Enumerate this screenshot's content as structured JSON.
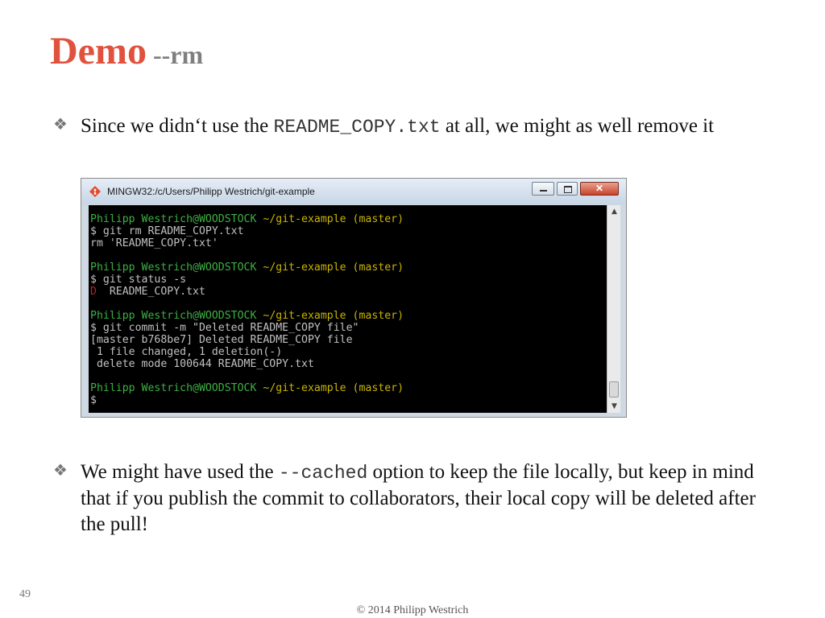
{
  "slide": {
    "title_main": "Demo",
    "title_sub": "--rm",
    "bullet1": {
      "pre": "Since we didn‘t use the ",
      "code": "README_COPY.txt",
      "post": " at all, we might as well remove it"
    },
    "bullet2": {
      "pre": "We might have used the ",
      "code": "--cached",
      "post": " option to keep the file locally, but keep in mind that if you publish the commit to collaborators, their local copy will be deleted after the pull!"
    },
    "bullet_icon": "diamond-bullet-icon",
    "page_number": "49",
    "footer": "© 2014 Philipp Westrich"
  },
  "terminal": {
    "window_title": "MINGW32:/c/Users/Philipp Westrich/git-example",
    "app_icon": "git-diamond-icon",
    "close_symbol": "✕",
    "scroll_up": "▲",
    "scroll_down": "▼",
    "prompt_user": "Philipp Westrich@WOODSTOCK",
    "prompt_path": "~/git-example (master)",
    "lines": [
      "$ git rm README_COPY.txt",
      "rm 'README_COPY.txt'",
      "$ git status -s",
      "D",
      "  README_COPY.txt",
      "$ git commit -m \"Deleted README_COPY file\"",
      "[master b768be7] Deleted README_COPY file",
      " 1 file changed, 1 deletion(-)",
      " delete mode 100644 README_COPY.txt",
      "$"
    ]
  },
  "colors": {
    "title": "#e0523d",
    "title_sub": "#7f7f7f",
    "prompt_user": "#3cb043",
    "prompt_path": "#c8b400",
    "deleted_status": "#b72222"
  }
}
